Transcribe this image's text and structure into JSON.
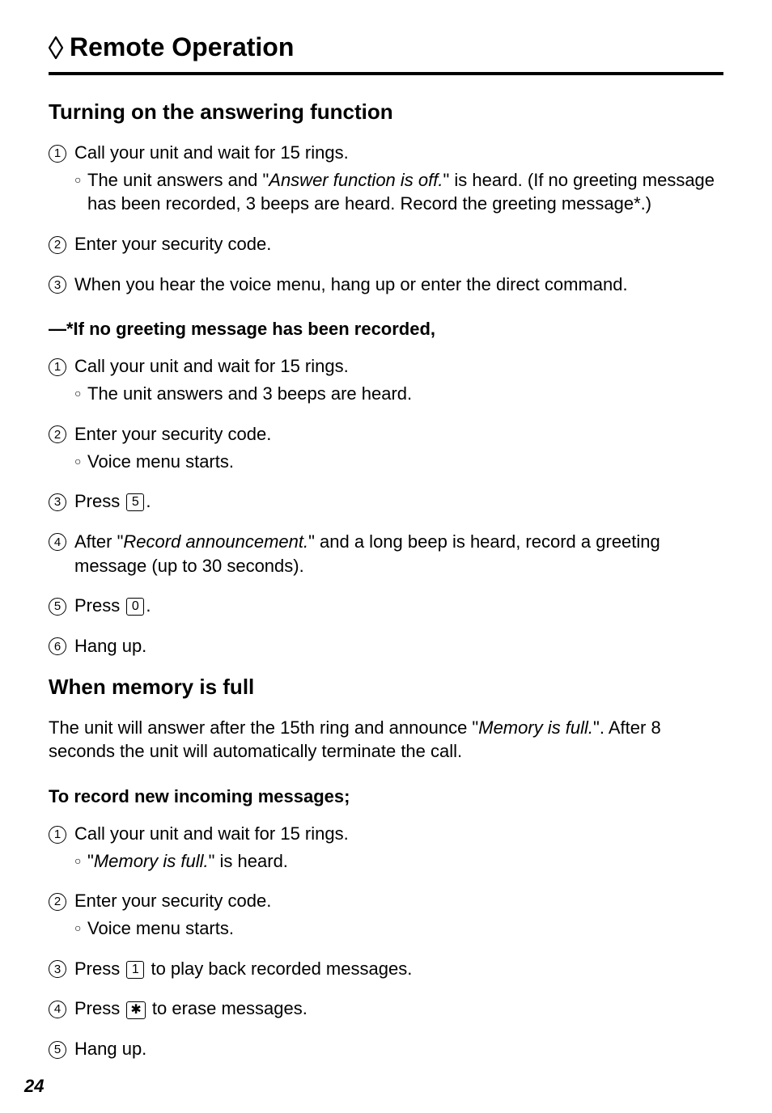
{
  "title": "Remote Operation",
  "section1": {
    "heading": "Turning on the answering function",
    "steps": [
      {
        "num": "1",
        "text": "Call your unit and wait for 15 rings.",
        "bullet_prefix": "The unit answers and \"",
        "bullet_italic": "Answer function is off.",
        "bullet_suffix": "\" is heard. (If no greeting message has been recorded, 3 beeps are heard. Record the greeting message*.)"
      },
      {
        "num": "2",
        "text": "Enter your security code."
      },
      {
        "num": "3",
        "text": "When you hear the voice menu, hang up or enter the direct command."
      }
    ],
    "sub_heading": "—*If no greeting message has been recorded,",
    "sub_steps": [
      {
        "num": "1",
        "text": "Call your unit and wait for 15 rings.",
        "bullet": "The unit answers and 3 beeps are heard."
      },
      {
        "num": "2",
        "text": "Enter your security code.",
        "bullet": "Voice menu starts."
      },
      {
        "num": "3",
        "text_prefix": "Press ",
        "key": "5",
        "text_suffix": "."
      },
      {
        "num": "4",
        "text_prefix": "After \"",
        "text_italic": "Record announcement.",
        "text_suffix": "\" and a long beep is heard, record a greeting message (up to 30 seconds)."
      },
      {
        "num": "5",
        "text_prefix": "Press ",
        "key": "0",
        "text_suffix": "."
      },
      {
        "num": "6",
        "text": "Hang up."
      }
    ]
  },
  "section2": {
    "heading": "When memory is full",
    "intro_prefix": "The unit will answer after the 15th ring and announce \"",
    "intro_italic": "Memory is full.",
    "intro_suffix": "\". After 8 seconds the unit will automatically terminate the call.",
    "sub_heading": "To record new incoming messages;",
    "steps": [
      {
        "num": "1",
        "text": "Call your unit and wait for 15 rings.",
        "bullet_prefix": "\"",
        "bullet_italic": "Memory is full.",
        "bullet_suffix": "\" is heard."
      },
      {
        "num": "2",
        "text": "Enter your security code.",
        "bullet": "Voice menu starts."
      },
      {
        "num": "3",
        "text_prefix": "Press ",
        "key": "1",
        "text_suffix": " to play back recorded messages."
      },
      {
        "num": "4",
        "text_prefix": "Press ",
        "key": "✱",
        "text_suffix": " to erase messages."
      },
      {
        "num": "5",
        "text": "Hang up."
      }
    ]
  },
  "page_number": "24"
}
